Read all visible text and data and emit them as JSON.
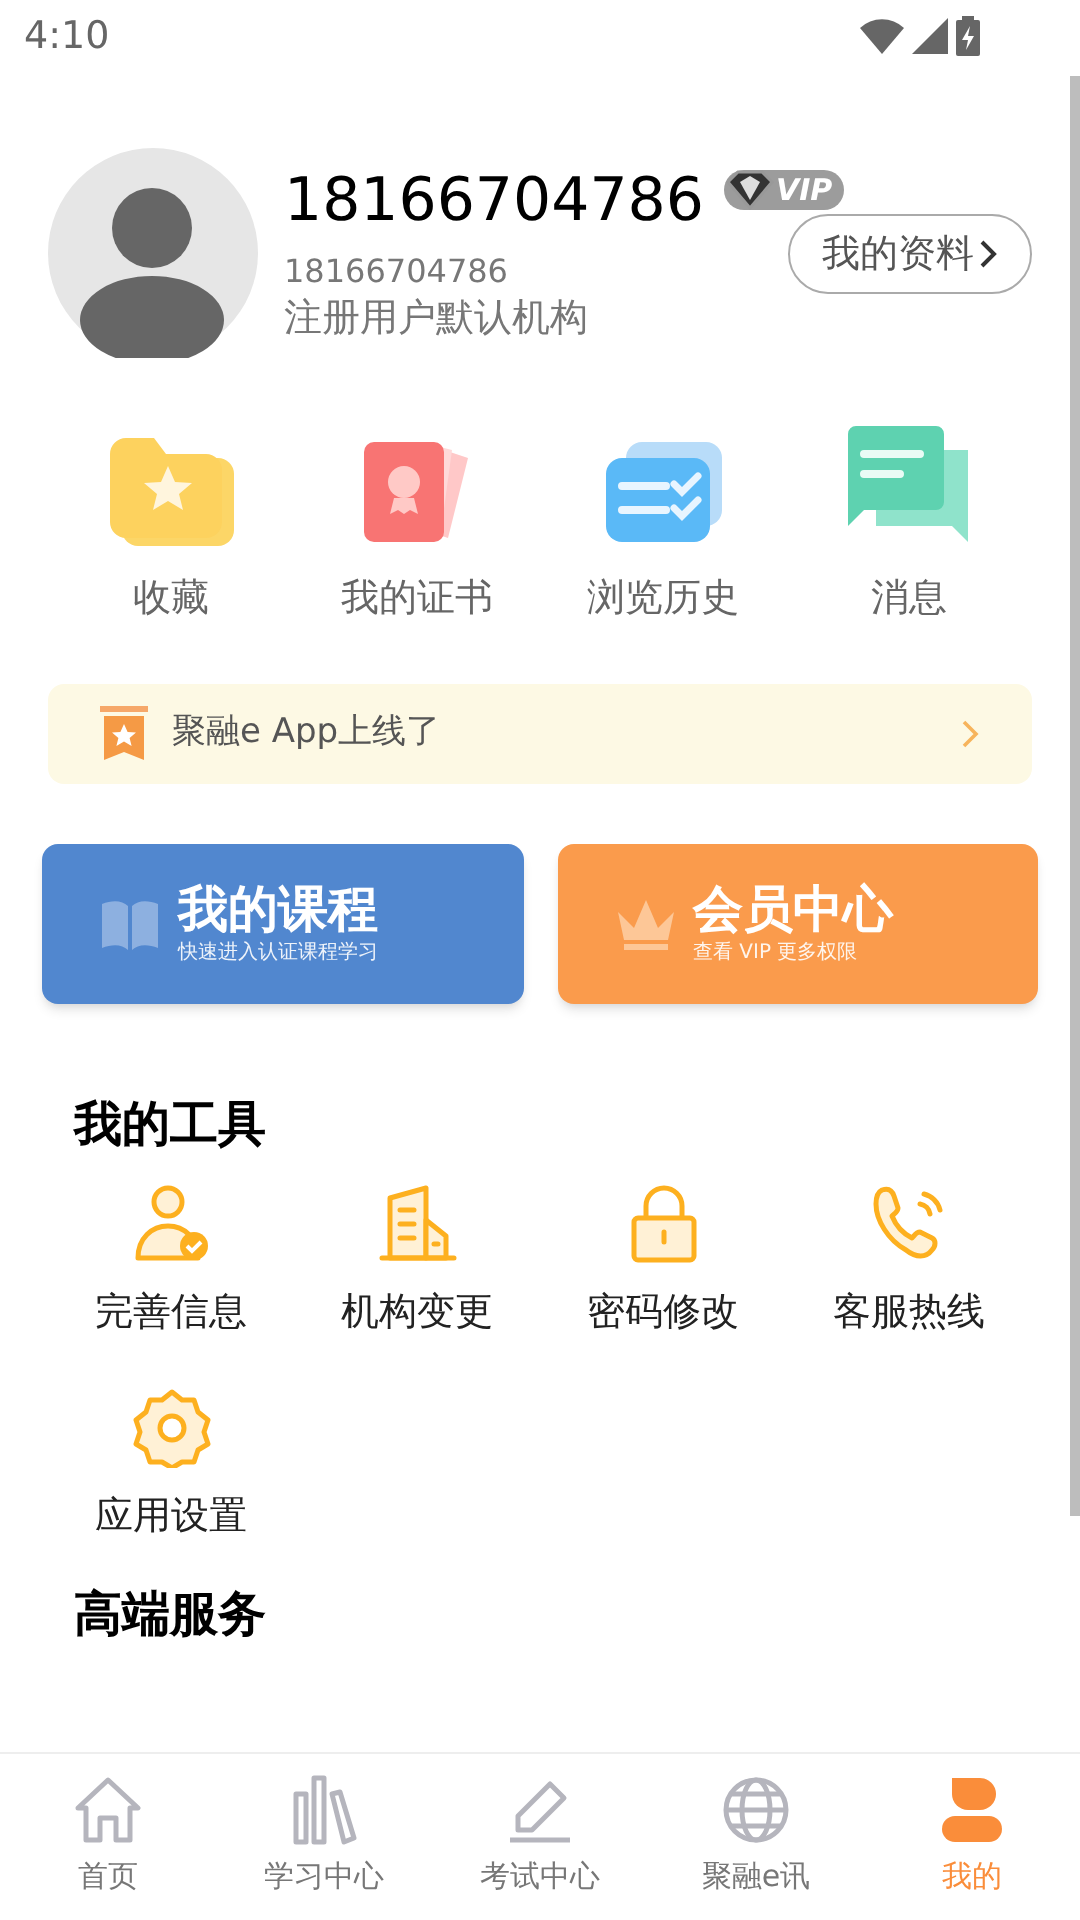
{
  "status_bar": {
    "time": "4:10"
  },
  "profile": {
    "name": "18166704786",
    "badge": "VIP",
    "account": "18166704786",
    "organization": "注册用户默认机构",
    "profile_button": "我的资料"
  },
  "shortcuts": [
    {
      "kind": "favorites",
      "label": "收藏"
    },
    {
      "kind": "certificates",
      "label": "我的证书"
    },
    {
      "kind": "history",
      "label": "浏览历史"
    },
    {
      "kind": "messages",
      "label": "消息"
    }
  ],
  "notice": {
    "text": "聚融e App上线了"
  },
  "cards": [
    {
      "kind": "courses",
      "title": "我的课程",
      "subtitle": "快速进入认证课程学习"
    },
    {
      "kind": "membership",
      "title": "会员中心",
      "subtitle": "查看 VIP 更多权限"
    }
  ],
  "tools": {
    "title": "我的工具",
    "items": [
      {
        "kind": "profile",
        "label": "完善信息"
      },
      {
        "kind": "building",
        "label": "机构变更"
      },
      {
        "kind": "lock",
        "label": "密码修改"
      },
      {
        "kind": "phone",
        "label": "客服热线"
      },
      {
        "kind": "settings",
        "label": "应用设置"
      }
    ]
  },
  "services": {
    "title": "高端服务"
  },
  "tab_bar": [
    {
      "kind": "home",
      "label": "首页",
      "selected": false
    },
    {
      "kind": "study",
      "label": "学习中心",
      "selected": false
    },
    {
      "kind": "exam",
      "label": "考试中心",
      "selected": false
    },
    {
      "kind": "globe",
      "label": "聚融e讯",
      "selected": false
    },
    {
      "kind": "me",
      "label": "我的",
      "selected": true
    }
  ]
}
